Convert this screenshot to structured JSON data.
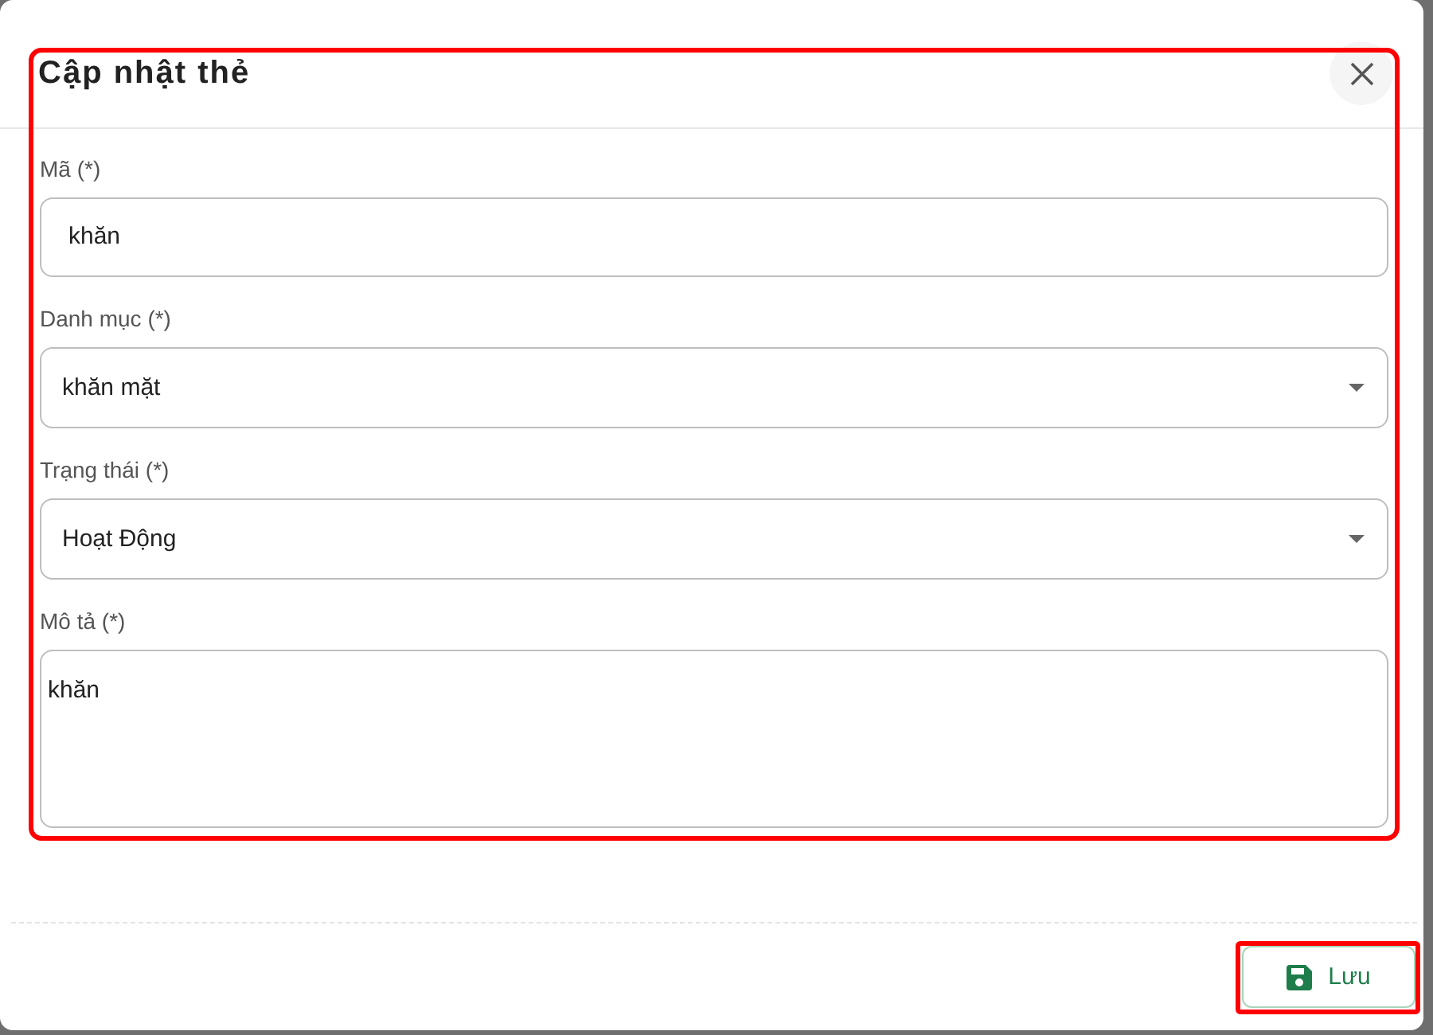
{
  "dialog": {
    "title": "Cập nhật thẻ",
    "highlighted": true
  },
  "fields": [
    {
      "kind": "text",
      "label": "Mã (*)",
      "value": "khăn"
    },
    {
      "kind": "select",
      "label": "Danh mục (*)",
      "value": "khăn mặt"
    },
    {
      "kind": "select",
      "label": "Trạng thái (*)",
      "value": "Hoạt Động"
    },
    {
      "kind": "textarea",
      "label": "Mô tả (*)",
      "value": "khăn"
    }
  ],
  "save_button": {
    "label": "Lưu",
    "highlighted": true
  }
}
